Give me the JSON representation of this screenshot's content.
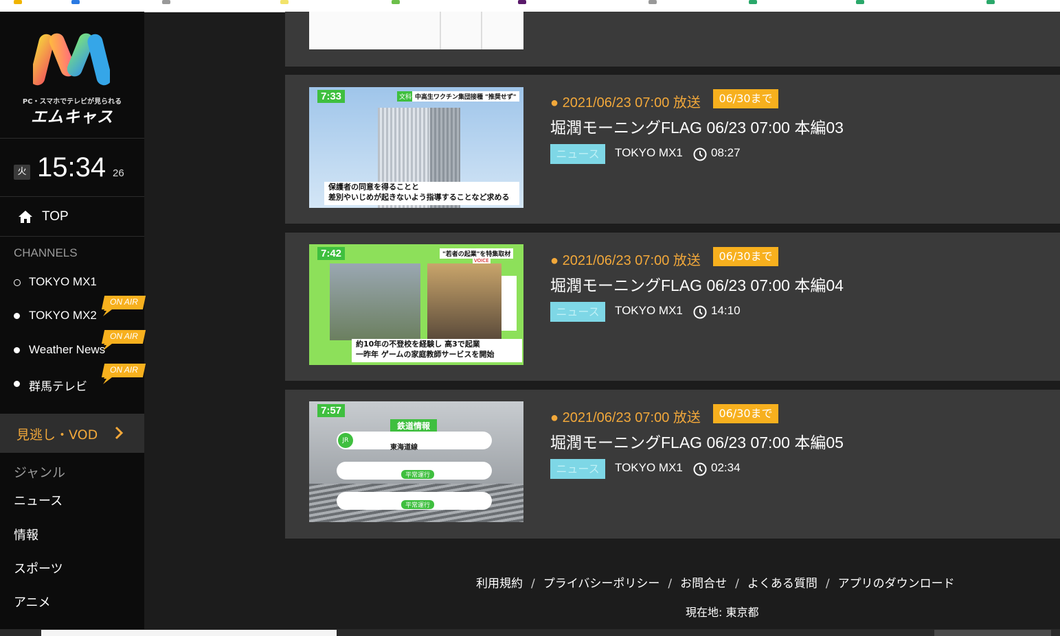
{
  "brand": {
    "tagline": "PC・スマホでテレビが見られる",
    "name": "エムキャス",
    "colors": {
      "orange": "#f2a83a",
      "onair": "#f7b01e",
      "genre_tag": "#7ed7e6"
    }
  },
  "clock": {
    "day": "火",
    "time": "15:34",
    "seconds": "26"
  },
  "nav": {
    "top_label": "TOP",
    "home_icon": "home-icon"
  },
  "channels": {
    "title": "CHANNELS",
    "items": [
      {
        "name": "TOKYO MX1",
        "on_air": false
      },
      {
        "name": "TOKYO MX2",
        "on_air": true,
        "badge": "ON AIR"
      },
      {
        "name": "Weather News",
        "on_air": true,
        "badge": "ON AIR"
      },
      {
        "name": "群馬テレビ",
        "on_air": true,
        "badge": "ON AIR"
      }
    ]
  },
  "vod": {
    "label": "見逃し・VOD"
  },
  "genres": {
    "title": "ジャンル",
    "items": [
      "ニュース",
      "情報",
      "スポーツ",
      "アニメ"
    ]
  },
  "programs": [
    {
      "aired": "● 2021/06/23 07:00 放送",
      "until": "06/30まで",
      "title": "堀潤モーニングFLAG 06/23 07:00 本編03",
      "genre": "ニュース",
      "channel": "TOKYO MX1",
      "duration": "08:27",
      "thumb_time": "7:33",
      "thumb_caption1": "保護者の同意を得ることと",
      "thumb_caption2": "差別やいじめが起きないよう指導することなど求める",
      "thumb_badge": "文科省",
      "thumb_headline": "中高生ワクチン集団接種 \"推奨せず\""
    },
    {
      "aired": "● 2021/06/23 07:00 放送",
      "until": "06/30まで",
      "title": "堀潤モーニングFLAG 06/23 07:00 本編04",
      "genre": "ニュース",
      "channel": "TOKYO MX1",
      "duration": "14:10",
      "thumb_time": "7:42",
      "thumb_caption1": "約10年の不登校を経験し 高3で起業",
      "thumb_caption2": "一昨年 ゲームの家庭教師サービスを開始",
      "thumb_badge": "VOICE",
      "thumb_headline": "\"若者の起業\"を特集取材"
    },
    {
      "aired": "● 2021/06/23 07:00 放送",
      "until": "06/30まで",
      "title": "堀潤モーニングFLAG 06/23 07:00 本編05",
      "genre": "ニュース",
      "channel": "TOKYO MX1",
      "duration": "02:34",
      "thumb_time": "7:57",
      "thumb_caption1": "東海道線",
      "thumb_caption2": "平常運行",
      "thumb_badge": "鉄道情報",
      "thumb_headline": "JR"
    }
  ],
  "footer": {
    "links": [
      "利用規約",
      "プライバシーポリシー",
      "お問合せ",
      "よくある質問",
      "アプリのダウンロード"
    ],
    "separator": "/",
    "location": "現在地: 東京都"
  }
}
